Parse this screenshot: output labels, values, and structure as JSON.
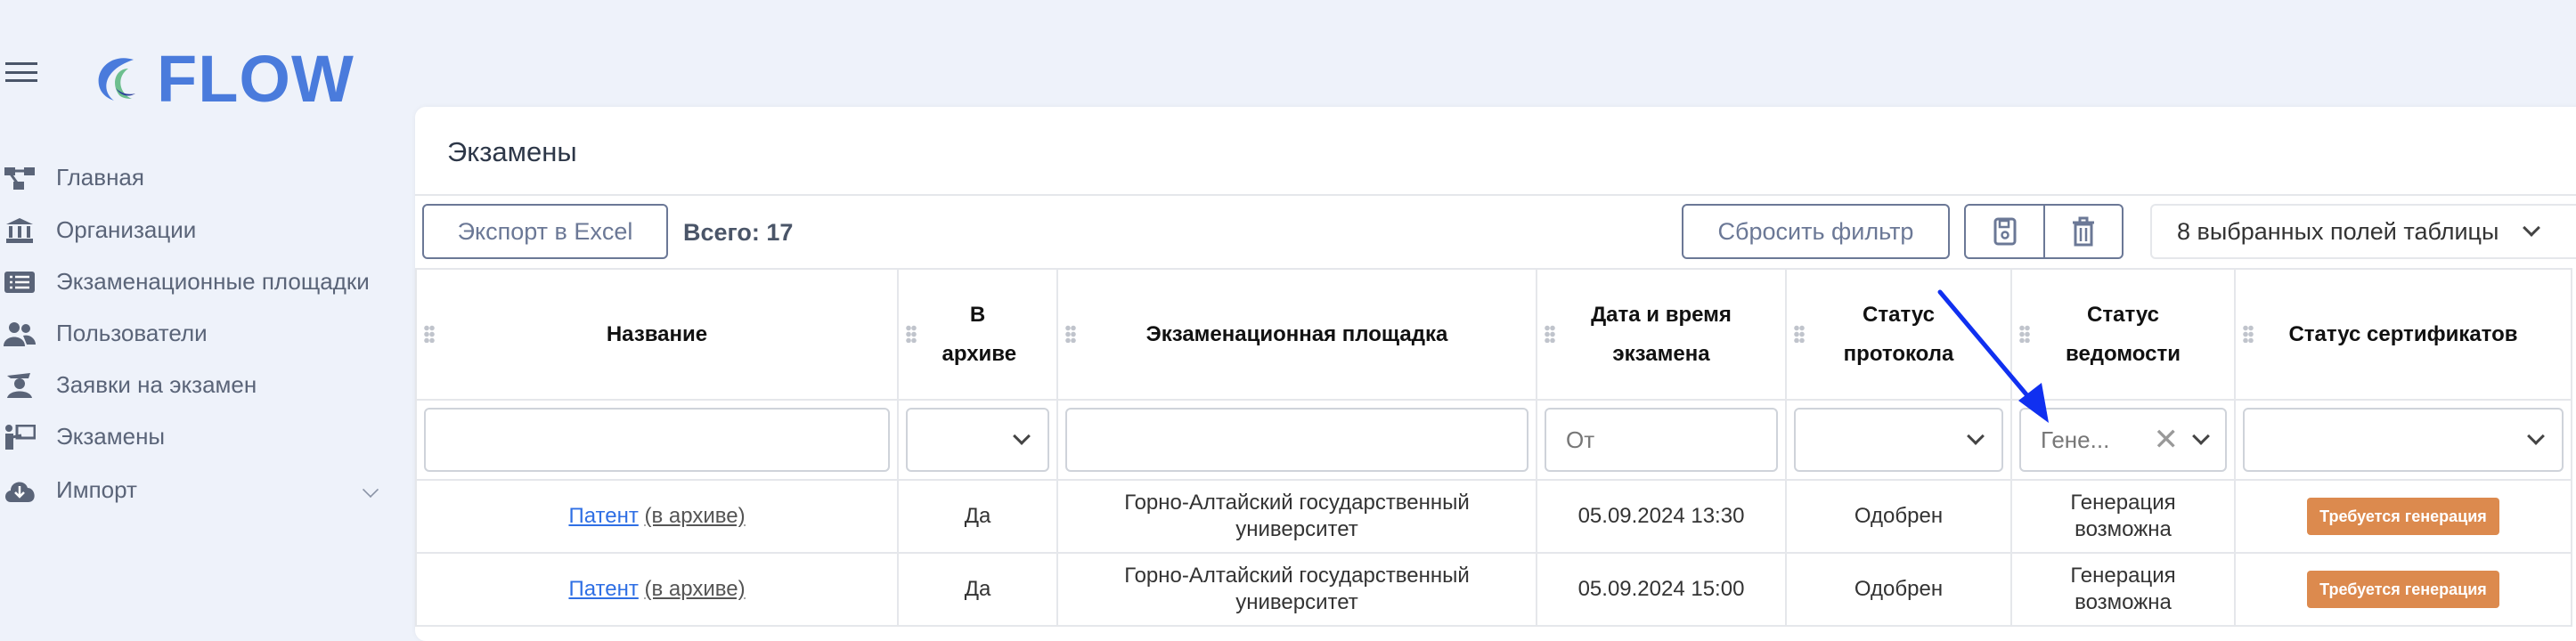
{
  "brand": {
    "name": "FLOW"
  },
  "sidebar": {
    "items": [
      {
        "label": "Главная",
        "icon": "sitemap-icon"
      },
      {
        "label": "Организации",
        "icon": "bank-icon"
      },
      {
        "label": "Экзаменационные площадки",
        "icon": "list-icon"
      },
      {
        "label": "Пользователи",
        "icon": "users-icon"
      },
      {
        "label": "Заявки на экзамен",
        "icon": "graduate-icon"
      },
      {
        "label": "Экзамены",
        "icon": "teacher-icon"
      },
      {
        "label": "Импорт",
        "icon": "cloud-download-icon"
      }
    ]
  },
  "page": {
    "title": "Экзамены"
  },
  "toolbar": {
    "export_label": "Экспорт в Excel",
    "total": "Всего: 17",
    "reset_label": "Сбросить фильтр",
    "fields_select": "8 выбранных полей таблицы"
  },
  "table": {
    "headers": [
      "Название",
      "В архиве",
      "Экзаменационная площадка",
      "Дата и время экзамена",
      "Статус протокола",
      "Статус ведомости",
      "Статус сертификатов"
    ],
    "filters": {
      "date_placeholder": "От",
      "sheet_status_value": "Гене..."
    },
    "rows": [
      {
        "name": "Патент",
        "archived_tag": "(в архиве)",
        "archive": "Да",
        "site": "Горно-Алтайский государственный университет",
        "datetime": "05.09.2024 13:30",
        "protocol": "Одобрен",
        "sheet": "Генерация возможна",
        "cert": "Требуется генерация"
      },
      {
        "name": "Патент",
        "archived_tag": "(в архиве)",
        "archive": "Да",
        "site": "Горно-Алтайский государственный университет",
        "datetime": "05.09.2024 15:00",
        "protocol": "Одобрен",
        "sheet": "Генерация возможна",
        "cert": "Требуется генерация"
      }
    ]
  },
  "colors": {
    "brand": "#4a7bdc",
    "badge": "#dc8a4e",
    "arrow": "#1030f0"
  }
}
